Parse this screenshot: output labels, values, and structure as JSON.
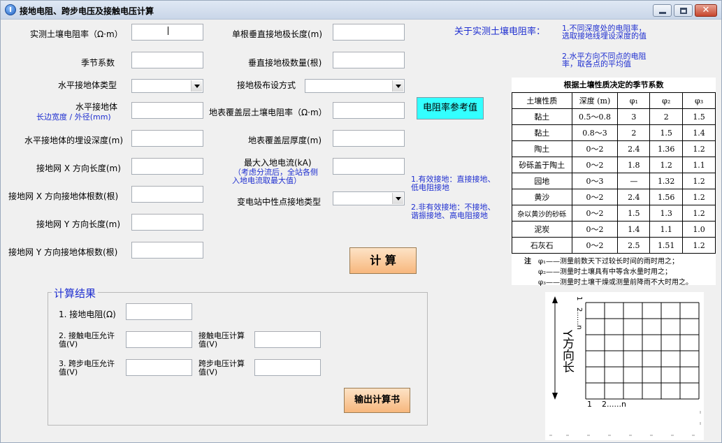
{
  "window": {
    "title": "接地电阻、跨步电压及接触电压计算",
    "minimize_icon": "minimize-icon",
    "maximize_icon": "maximize-icon",
    "close_icon": "close-icon"
  },
  "left_form": {
    "soil_resistivity": "实测土壤电阻率（Ω·m）",
    "seasonal_factor": "季节系数",
    "horizontal_type": "水平接地体类型",
    "horizontal_width_label": "水平接地体",
    "horizontal_width_sub": "长边宽度 / 外径(mm)",
    "burial_depth": "水平接地体的埋设深度(m)",
    "grid_x_length": "接地网 X 方向长度(m)",
    "grid_x_count": "接地网 X 方向接地体根数(根)",
    "grid_y_length": "接地网 Y 方向长度(m)",
    "grid_y_count": "接地网 Y 方向接地体根数(根)"
  },
  "right_form": {
    "vertical_length": "单根垂直接地极长度(m)",
    "vertical_count": "垂直接地极数量(根)",
    "layout_mode": "接地极布设方式",
    "surface_resistivity": "地表覆盖层土壤电阻率（Ω·m）",
    "surface_thickness": "地表覆盖层厚度(m)",
    "max_current": "最大入地电流(kA)",
    "max_current_note_1": "（考虑分流后，全站各侧",
    "max_current_note_2": "入地电流取最大值）",
    "neutral_grounding": "变电站中性点接地类型"
  },
  "buttons": {
    "resistivity_ref": "电阻率参考值",
    "calculate": "计 算",
    "export": "输出计算书"
  },
  "notes": {
    "soil_title": "关于实测土壤电阻率：",
    "soil_1a": "1.不同深度处的电阻率，",
    "soil_1b": "选取接地线埋设深度的值",
    "soil_2a": "2.水平方向不同点的电阻",
    "soil_2b": "率，取各点的平均值",
    "ground_1a": "1.有效接地：直接接地、",
    "ground_1b": "低电阻接地",
    "ground_2a": "2.非有效接地：不接地、",
    "ground_2b": "谐振接地、高电阻接地"
  },
  "results": {
    "legend": "计算结果",
    "resistance": "1. 接地电阻(Ω)",
    "touch_allow_a": "2. 接触电压允许",
    "touch_allow_b": "值(V)",
    "touch_calc_a": "接触电压计算",
    "touch_calc_b": "值(V)",
    "step_allow_a": "3. 跨步电压允许",
    "step_allow_b": "值(V)",
    "step_calc_a": "跨步电压计算",
    "step_calc_b": "值(V)"
  },
  "seasonal_table": {
    "caption": "根据土壤性质决定的季节系数",
    "headers": [
      "土壤性质",
      "深度 (m)",
      "φ₁",
      "φ₂",
      "φ₃"
    ],
    "rows": [
      [
        "黏土",
        "0.5～0.8",
        "3",
        "2",
        "1.5"
      ],
      [
        "黏土",
        "0.8～3",
        "2",
        "1.5",
        "1.4"
      ],
      [
        "陶土",
        "0～2",
        "2.4",
        "1.36",
        "1.2"
      ],
      [
        "砂砾盖于陶土",
        "0～2",
        "1.8",
        "1.2",
        "1.1"
      ],
      [
        "园地",
        "0～3",
        "—",
        "1.32",
        "1.2"
      ],
      [
        "黄沙",
        "0～2",
        "2.4",
        "1.56",
        "1.2"
      ],
      [
        "杂以黄沙的砂砾",
        "0～2",
        "1.5",
        "1.3",
        "1.2"
      ],
      [
        "泥炭",
        "0～2",
        "1.4",
        "1.1",
        "1.0"
      ],
      [
        "石灰石",
        "0～2",
        "2.5",
        "1.51",
        "1.2"
      ]
    ],
    "note_head": "注",
    "note_1": "φ₁——测量前数天下过较长时间的雨时用之；",
    "note_2": "φ₂——测量时土壤具有中等含水量时用之；",
    "note_3": "φ₃——测量时土壤干燥或测量前降雨不大时用之。"
  },
  "grid_figure": {
    "y_label": "Y方向长",
    "row_index_1": "1",
    "row_index_2": "2......n",
    "col_index": "1    2......n"
  }
}
